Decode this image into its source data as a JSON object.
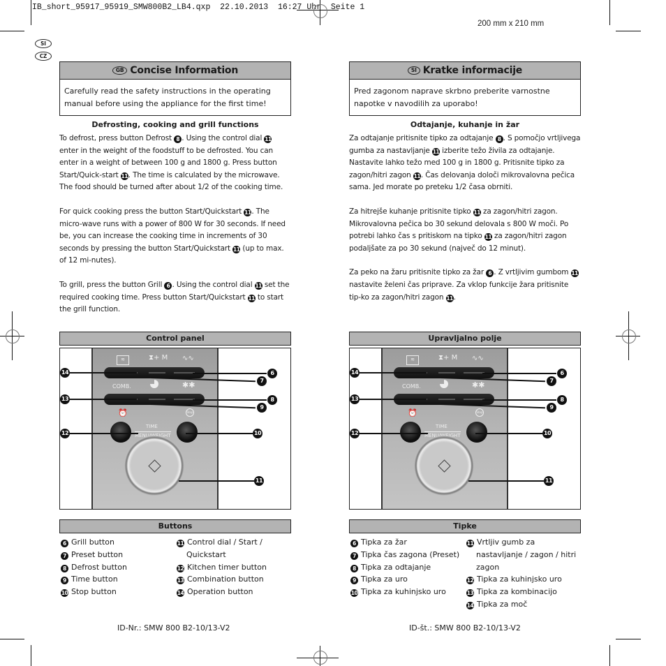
{
  "slug": "IB_short_95917_95919_SMW800B2_LB4.qxp  22.10.2013  16:27 Uhr  Seite 1",
  "format": "200 mm x 210 mm",
  "lang_badges": [
    "SI",
    "CZ"
  ],
  "colors": {
    "header_gray": "#b3b3b3",
    "text": "#1a1a1a",
    "border": "#222222"
  },
  "left": {
    "badge": "GB",
    "title": "Concise Information",
    "intro": "Carefully read the safety instructions in the operating manual before using the appliance for the first time!",
    "section_title": "Defrosting, cooking and grill functions",
    "paragraphs": [
      [
        "To defrost, press button Defrost ",
        "8",
        ". Using the control dial ",
        "11",
        " enter in the weight of the foodstuff to be defrosted. You can enter in a weight of between 100 g and 1800 g. Press button Start/Quick-start ",
        "11",
        ". The time is calculated by the microwave. The food should be turned after about 1/2 of the cooking time."
      ],
      [
        "For quick cooking press the button Start/Quickstart ",
        "11",
        ". The micro-wave runs with a power of 800 W for 30 seconds. If need be, you can increase the cooking time in increments of 30 seconds by pressing the button Start/Quickstart ",
        "11",
        " (up to max. of 12 mi-nutes)."
      ],
      [
        "To grill, press the button Grill ",
        "6",
        ". Using the control dial ",
        "11",
        " set the required cooking time. Press button Start/Quickstart ",
        "11",
        " to start the grill function."
      ]
    ],
    "panel_title": "Control panel",
    "buttons_title": "Buttons",
    "legend_left": [
      {
        "n": "6",
        "text": "Grill button"
      },
      {
        "n": "7",
        "text": "Preset button"
      },
      {
        "n": "8",
        "text": "Defrost button"
      },
      {
        "n": "9",
        "text": "Time button"
      },
      {
        "n": "10",
        "text": "Stop button"
      }
    ],
    "legend_right": [
      {
        "n": "11",
        "text": "Control dial / Start / Quickstart"
      },
      {
        "n": "12",
        "text": "Kitchen timer button"
      },
      {
        "n": "13",
        "text": "Combination button"
      },
      {
        "n": "14",
        "text": "Operation button"
      }
    ],
    "footer": "ID-Nr.: SMW 800 B2-10/13-V2"
  },
  "right": {
    "badge": "SI",
    "title": "Kratke informacije",
    "intro": "Pred zagonom naprave skrbno preberite varnostne napotke v navodilih za uporabo!",
    "section_title": "Odtajanje, kuhanje in žar",
    "paragraphs": [
      [
        "Za odtajanje pritisnite tipko za odtajanje ",
        "8",
        ". S pomočjo vrtljivega gumba za nastavljanje ",
        "11",
        " izberite težo živila za odtajanje. Nastavite lahko težo med 100 g in 1800 g. Pritisnite tipko za zagon/hitri zagon ",
        "11",
        ". Čas delovanja določi mikrovalovna pečica sama. Jed morate po preteku 1/2 časa obrniti."
      ],
      [
        "Za hitrejše kuhanje pritisnite tipko ",
        "11",
        " za zagon/hitri zagon. Mikrovalovna pečica bo 30 sekund delovala s 800 W moči. Po potrebi lahko čas s pritiskom na tipko ",
        "11",
        " za zagon/hitri zagon podaljšate za po 30 sekund (največ do 12 minut)."
      ],
      [
        "Za peko na žaru pritisnite tipko za žar ",
        "6",
        ". Z vrtljivim gumbom ",
        "11",
        " nastavite želeni čas priprave. Za vklop funkcije žara pritisnite tip-ko za zagon/hitri zagon ",
        "11",
        "."
      ]
    ],
    "panel_title": "Upravljalno polje",
    "buttons_title": "Tipke",
    "legend_left": [
      {
        "n": "6",
        "text": "Tipka za žar"
      },
      {
        "n": "7",
        "text": "Tipka čas zagona (Preset)"
      },
      {
        "n": "8",
        "text": "Tipka za odtajanje"
      },
      {
        "n": "9",
        "text": "Tipka za uro"
      },
      {
        "n": "10",
        "text": "Tipka za kuhinjsko uro"
      }
    ],
    "legend_right": [
      {
        "n": "11",
        "text": "Vrtljiv gumb za nastavljanje / zagon / hitri zagon"
      },
      {
        "n": "12",
        "text": "Tipka za kuhinjsko uro"
      },
      {
        "n": "13",
        "text": "Tipka za kombinacijo"
      },
      {
        "n": "14",
        "text": "Tipka za moč"
      }
    ],
    "footer": "ID-št.: SMW 800 B2-10/13-V2"
  },
  "panel": {
    "labels": {
      "comb": "COMB.",
      "power_m": "+ M",
      "time": "TIME",
      "menu_weight": "MENU/WEIGHT",
      "stop": "Stop"
    },
    "callouts": [
      "14",
      "7",
      "6",
      "13",
      "9",
      "8",
      "12",
      "10",
      "11"
    ]
  }
}
